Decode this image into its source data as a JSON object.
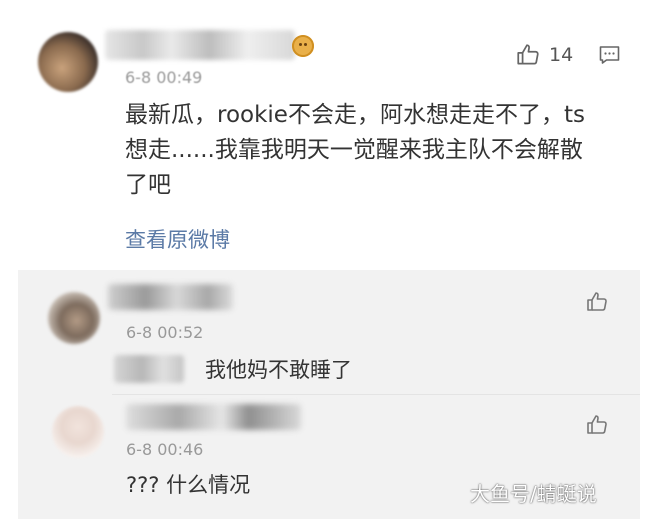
{
  "main_comment": {
    "time": "6-8 00:49",
    "like_count": "14",
    "text_lines": [
      "最新瓜，rookie不会走，阿水想走走不了，ts",
      "想走......我靠我明天一觉醒来我主队不会解散",
      "了吧"
    ],
    "view_original_label": "查看原微博"
  },
  "replies": [
    {
      "time": "6-8 00:52",
      "text": "我他妈不敢睡了"
    },
    {
      "time": "6-8 00:46",
      "text": "??? 什么情况"
    }
  ],
  "watermark": "大鱼号/蜻蜓说",
  "icons": {
    "like": "thumbs-up-icon",
    "comment": "comment-icon",
    "badge": "member-badge-icon"
  },
  "colors": {
    "link": "#5b7aa6",
    "meta": "#999999",
    "text": "#333333",
    "reply_bg": "#f2f2f2"
  }
}
